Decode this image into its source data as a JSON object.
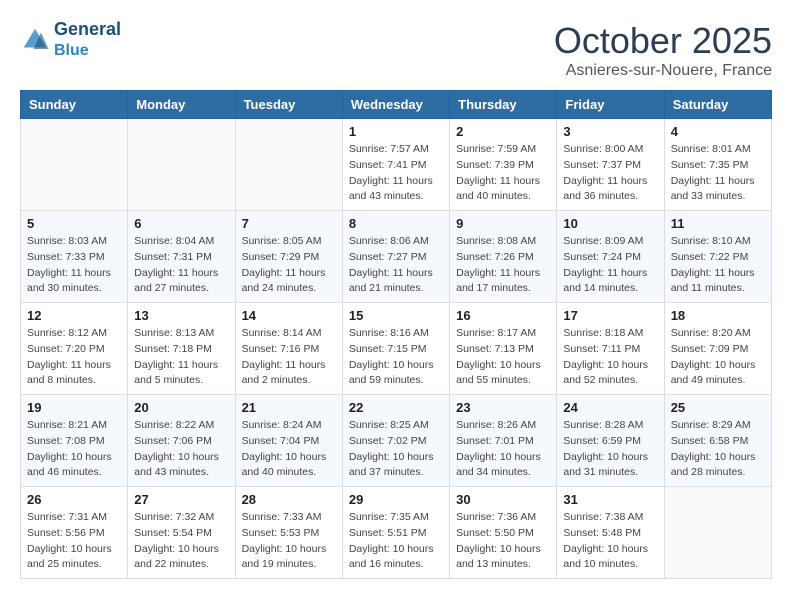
{
  "header": {
    "logo_line1": "General",
    "logo_line2": "Blue",
    "month": "October 2025",
    "location": "Asnieres-sur-Nouere, France"
  },
  "days_of_week": [
    "Sunday",
    "Monday",
    "Tuesday",
    "Wednesday",
    "Thursday",
    "Friday",
    "Saturday"
  ],
  "weeks": [
    [
      {
        "day": "",
        "detail": ""
      },
      {
        "day": "",
        "detail": ""
      },
      {
        "day": "",
        "detail": ""
      },
      {
        "day": "1",
        "detail": "Sunrise: 7:57 AM\nSunset: 7:41 PM\nDaylight: 11 hours\nand 43 minutes."
      },
      {
        "day": "2",
        "detail": "Sunrise: 7:59 AM\nSunset: 7:39 PM\nDaylight: 11 hours\nand 40 minutes."
      },
      {
        "day": "3",
        "detail": "Sunrise: 8:00 AM\nSunset: 7:37 PM\nDaylight: 11 hours\nand 36 minutes."
      },
      {
        "day": "4",
        "detail": "Sunrise: 8:01 AM\nSunset: 7:35 PM\nDaylight: 11 hours\nand 33 minutes."
      }
    ],
    [
      {
        "day": "5",
        "detail": "Sunrise: 8:03 AM\nSunset: 7:33 PM\nDaylight: 11 hours\nand 30 minutes."
      },
      {
        "day": "6",
        "detail": "Sunrise: 8:04 AM\nSunset: 7:31 PM\nDaylight: 11 hours\nand 27 minutes."
      },
      {
        "day": "7",
        "detail": "Sunrise: 8:05 AM\nSunset: 7:29 PM\nDaylight: 11 hours\nand 24 minutes."
      },
      {
        "day": "8",
        "detail": "Sunrise: 8:06 AM\nSunset: 7:27 PM\nDaylight: 11 hours\nand 21 minutes."
      },
      {
        "day": "9",
        "detail": "Sunrise: 8:08 AM\nSunset: 7:26 PM\nDaylight: 11 hours\nand 17 minutes."
      },
      {
        "day": "10",
        "detail": "Sunrise: 8:09 AM\nSunset: 7:24 PM\nDaylight: 11 hours\nand 14 minutes."
      },
      {
        "day": "11",
        "detail": "Sunrise: 8:10 AM\nSunset: 7:22 PM\nDaylight: 11 hours\nand 11 minutes."
      }
    ],
    [
      {
        "day": "12",
        "detail": "Sunrise: 8:12 AM\nSunset: 7:20 PM\nDaylight: 11 hours\nand 8 minutes."
      },
      {
        "day": "13",
        "detail": "Sunrise: 8:13 AM\nSunset: 7:18 PM\nDaylight: 11 hours\nand 5 minutes."
      },
      {
        "day": "14",
        "detail": "Sunrise: 8:14 AM\nSunset: 7:16 PM\nDaylight: 11 hours\nand 2 minutes."
      },
      {
        "day": "15",
        "detail": "Sunrise: 8:16 AM\nSunset: 7:15 PM\nDaylight: 10 hours\nand 59 minutes."
      },
      {
        "day": "16",
        "detail": "Sunrise: 8:17 AM\nSunset: 7:13 PM\nDaylight: 10 hours\nand 55 minutes."
      },
      {
        "day": "17",
        "detail": "Sunrise: 8:18 AM\nSunset: 7:11 PM\nDaylight: 10 hours\nand 52 minutes."
      },
      {
        "day": "18",
        "detail": "Sunrise: 8:20 AM\nSunset: 7:09 PM\nDaylight: 10 hours\nand 49 minutes."
      }
    ],
    [
      {
        "day": "19",
        "detail": "Sunrise: 8:21 AM\nSunset: 7:08 PM\nDaylight: 10 hours\nand 46 minutes."
      },
      {
        "day": "20",
        "detail": "Sunrise: 8:22 AM\nSunset: 7:06 PM\nDaylight: 10 hours\nand 43 minutes."
      },
      {
        "day": "21",
        "detail": "Sunrise: 8:24 AM\nSunset: 7:04 PM\nDaylight: 10 hours\nand 40 minutes."
      },
      {
        "day": "22",
        "detail": "Sunrise: 8:25 AM\nSunset: 7:02 PM\nDaylight: 10 hours\nand 37 minutes."
      },
      {
        "day": "23",
        "detail": "Sunrise: 8:26 AM\nSunset: 7:01 PM\nDaylight: 10 hours\nand 34 minutes."
      },
      {
        "day": "24",
        "detail": "Sunrise: 8:28 AM\nSunset: 6:59 PM\nDaylight: 10 hours\nand 31 minutes."
      },
      {
        "day": "25",
        "detail": "Sunrise: 8:29 AM\nSunset: 6:58 PM\nDaylight: 10 hours\nand 28 minutes."
      }
    ],
    [
      {
        "day": "26",
        "detail": "Sunrise: 7:31 AM\nSunset: 5:56 PM\nDaylight: 10 hours\nand 25 minutes."
      },
      {
        "day": "27",
        "detail": "Sunrise: 7:32 AM\nSunset: 5:54 PM\nDaylight: 10 hours\nand 22 minutes."
      },
      {
        "day": "28",
        "detail": "Sunrise: 7:33 AM\nSunset: 5:53 PM\nDaylight: 10 hours\nand 19 minutes."
      },
      {
        "day": "29",
        "detail": "Sunrise: 7:35 AM\nSunset: 5:51 PM\nDaylight: 10 hours\nand 16 minutes."
      },
      {
        "day": "30",
        "detail": "Sunrise: 7:36 AM\nSunset: 5:50 PM\nDaylight: 10 hours\nand 13 minutes."
      },
      {
        "day": "31",
        "detail": "Sunrise: 7:38 AM\nSunset: 5:48 PM\nDaylight: 10 hours\nand 10 minutes."
      },
      {
        "day": "",
        "detail": ""
      }
    ]
  ]
}
